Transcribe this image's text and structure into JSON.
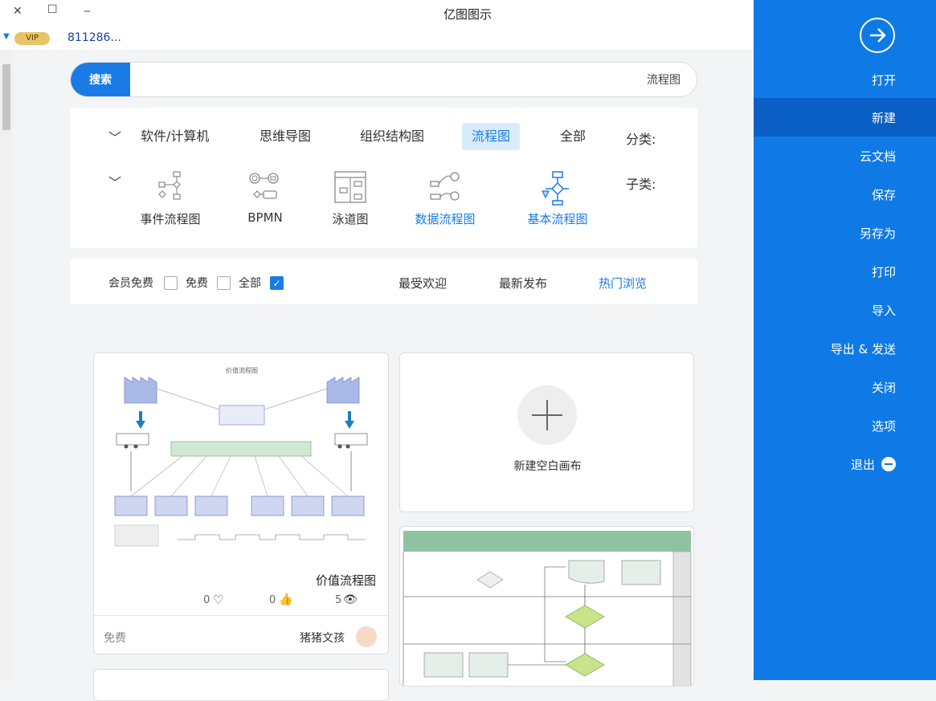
{
  "window": {
    "title": "亿图图示",
    "controls": {
      "minimize": "‒",
      "maximize": "☐",
      "close": "✕"
    }
  },
  "user": {
    "vip": "VIP",
    "account": "811286..."
  },
  "sidebar": {
    "items": [
      {
        "label": "打开"
      },
      {
        "label": "新建"
      },
      {
        "label": "云文档"
      },
      {
        "label": "保存"
      },
      {
        "label": "另存为"
      },
      {
        "label": "打印"
      },
      {
        "label": "导入"
      },
      {
        "label": "导出 & 发送"
      },
      {
        "label": "关闭"
      },
      {
        "label": "选项"
      },
      {
        "label": "退出"
      }
    ],
    "active": "新建",
    "colors": {
      "bg": "#0f7ae5",
      "active": "#0a5fc6"
    }
  },
  "search": {
    "button": "搜索",
    "value": "流程图"
  },
  "categories": {
    "label": "分类:",
    "items": [
      "全部",
      "流程图",
      "组织结构图",
      "思维导图",
      "软件/计算机"
    ],
    "active": "流程图"
  },
  "subcategories": {
    "label": "子类:",
    "items": [
      "基本流程图",
      "数据流程图",
      "泳道图",
      "BPMN",
      "事件流程图"
    ],
    "highlighted": [
      "基本流程图",
      "数据流程图"
    ]
  },
  "sort_tabs": {
    "items": [
      "热门浏览",
      "最新发布",
      "最受欢迎"
    ],
    "active": "热门浏览"
  },
  "price_filter": {
    "items": [
      "全部",
      "免费",
      "会员免费"
    ],
    "checked": "全部"
  },
  "new_canvas": {
    "label": "新建空白画布"
  },
  "template_card": {
    "title": "价值流程图",
    "views": "5",
    "likes": "0",
    "favorites": "0",
    "author": "猪猪文孩",
    "price": "免费",
    "diagram_title": "价值流程图"
  }
}
